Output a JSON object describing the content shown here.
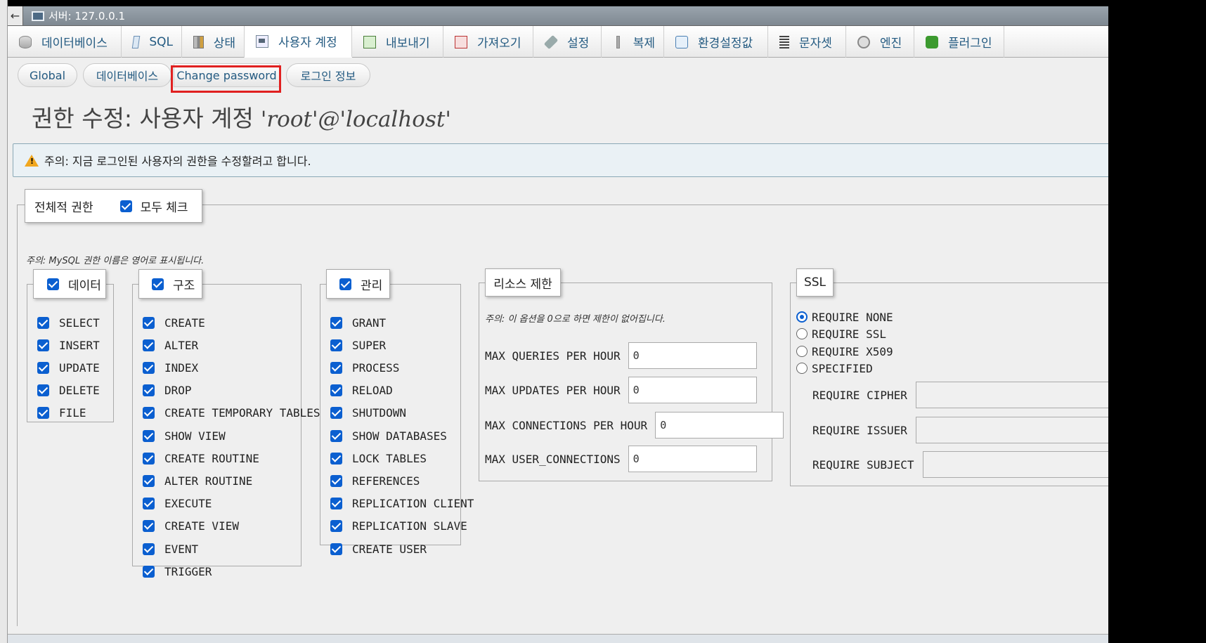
{
  "server_bar": {
    "back": "←",
    "label": "서버: 127.0.0.1"
  },
  "tabs": [
    {
      "label": "데이터베이스",
      "icon": "database-icon"
    },
    {
      "label": "SQL",
      "icon": "sql-icon"
    },
    {
      "label": "상태",
      "icon": "status-icon"
    },
    {
      "label": "사용자 계정",
      "icon": "user-accounts-icon",
      "active": true
    },
    {
      "label": "내보내기",
      "icon": "export-icon"
    },
    {
      "label": "가져오기",
      "icon": "import-icon"
    },
    {
      "label": "설정",
      "icon": "wrench-icon"
    },
    {
      "label": "복제",
      "icon": "replication-icon"
    },
    {
      "label": "환경설정값",
      "icon": "variables-icon"
    },
    {
      "label": "문자셋",
      "icon": "charset-icon"
    },
    {
      "label": "엔진",
      "icon": "engine-icon"
    },
    {
      "label": "플러그인",
      "icon": "plugin-icon"
    }
  ],
  "subtabs": {
    "global": "Global",
    "database": "데이터베이스",
    "change_password": "Change password",
    "login_info": "로그인 정보"
  },
  "title": {
    "prefix": "권한 수정: 사용자 계정",
    "user": "'root'@'localhost'"
  },
  "notice": "주의: 지금 로그인된 사용자의 권한을 수정할려고 합니다.",
  "global": {
    "legend": "전체적 권한",
    "check_all": "모두 체크",
    "note": "주의: MySQL 권한 이름은 영어로 표시됩니다."
  },
  "data_group": {
    "legend": "데이터",
    "items": [
      "SELECT",
      "INSERT",
      "UPDATE",
      "DELETE",
      "FILE"
    ]
  },
  "structure_group": {
    "legend": "구조",
    "items": [
      "CREATE",
      "ALTER",
      "INDEX",
      "DROP",
      "CREATE TEMPORARY TABLES",
      "SHOW VIEW",
      "CREATE ROUTINE",
      "ALTER ROUTINE",
      "EXECUTE",
      "CREATE VIEW",
      "EVENT",
      "TRIGGER"
    ]
  },
  "admin_group": {
    "legend": "관리",
    "items": [
      "GRANT",
      "SUPER",
      "PROCESS",
      "RELOAD",
      "SHUTDOWN",
      "SHOW DATABASES",
      "LOCK TABLES",
      "REFERENCES",
      "REPLICATION CLIENT",
      "REPLICATION SLAVE",
      "CREATE USER"
    ]
  },
  "resource": {
    "legend": "리소스 제한",
    "note": "주의: 이 옵션을 0으로 하면 제한이 없어집니다.",
    "rows": [
      {
        "label": "MAX QUERIES PER HOUR",
        "value": "0"
      },
      {
        "label": "MAX UPDATES PER HOUR",
        "value": "0"
      },
      {
        "label": "MAX CONNECTIONS PER HOUR",
        "value": "0"
      },
      {
        "label": "MAX USER_CONNECTIONS",
        "value": "0"
      }
    ]
  },
  "ssl": {
    "legend": "SSL",
    "options": [
      "REQUIRE NONE",
      "REQUIRE SSL",
      "REQUIRE X509",
      "SPECIFIED"
    ],
    "selected": "REQUIRE NONE",
    "fields": [
      "REQUIRE CIPHER",
      "REQUIRE ISSUER",
      "REQUIRE SUBJECT"
    ]
  },
  "colors": {
    "accent": "#0b5fd0",
    "link": "#235a81",
    "highlight": "#e02020",
    "warning": "#f1a71f"
  }
}
